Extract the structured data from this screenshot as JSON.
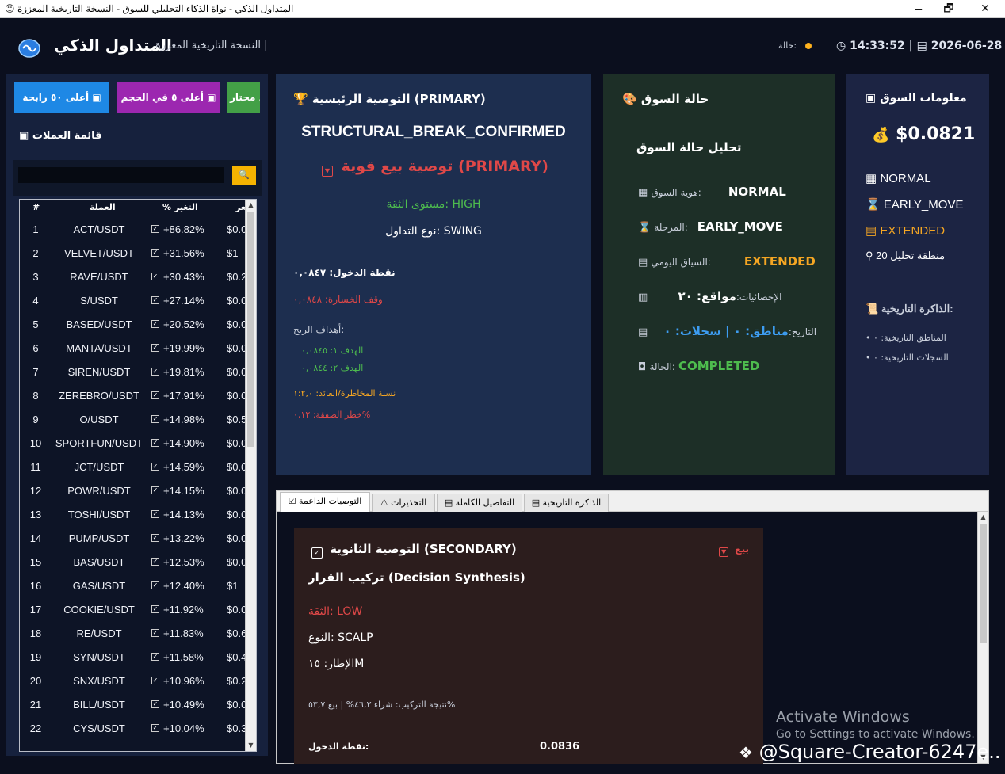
{
  "window": {
    "title": "المتداول الذكي - نواة الذكاء التحليلي للسوق - النسخة التاريخية المعززة",
    "minimize": "🗕",
    "maximize": "🗗",
    "close": "✕"
  },
  "header": {
    "app_title": "المتداول الذكي",
    "subtitle": "النسخة التاريخية المعززة |",
    "status_label": "حالة:",
    "status_color": "#ffb21e",
    "time": "14:33:52",
    "separator": "|",
    "date": "2026-06-28"
  },
  "filters": [
    {
      "label": "أعلى ٥٠ رابحة",
      "color": "#1e88e5"
    },
    {
      "label": "أعلى ٥ في الحجم",
      "color": "#9c27b0"
    },
    {
      "label": "ل مختار",
      "color": "#43a047"
    }
  ],
  "currency_list": {
    "title": "قائمة العملات",
    "search_icon": "search-icon",
    "columns": [
      "#",
      "العملة",
      "% التغير",
      "السعر"
    ],
    "rows": [
      {
        "n": "1",
        "symbol": "ACT/USDT",
        "change": "+86.82%",
        "price": "$0.0"
      },
      {
        "n": "2",
        "symbol": "VELVET/USDT",
        "change": "+31.56%",
        "price": "$1"
      },
      {
        "n": "3",
        "symbol": "RAVE/USDT",
        "change": "+30.43%",
        "price": "$0.2"
      },
      {
        "n": "4",
        "symbol": "S/USDT",
        "change": "+27.14%",
        "price": "$0.0"
      },
      {
        "n": "5",
        "symbol": "BASED/USDT",
        "change": "+20.52%",
        "price": "$0.0"
      },
      {
        "n": "6",
        "symbol": "MANTA/USDT",
        "change": "+19.99%",
        "price": "$0.0"
      },
      {
        "n": "7",
        "symbol": "SIREN/USDT",
        "change": "+19.81%",
        "price": "$0.0"
      },
      {
        "n": "8",
        "symbol": "ZEREBRO/USDT",
        "change": "+17.91%",
        "price": "$0.0"
      },
      {
        "n": "9",
        "symbol": "O/USDT",
        "change": "+14.98%",
        "price": "$0.5"
      },
      {
        "n": "10",
        "symbol": "SPORTFUN/USDT",
        "change": "+14.90%",
        "price": "$0.0"
      },
      {
        "n": "11",
        "symbol": "JCT/USDT",
        "change": "+14.59%",
        "price": "$0.00"
      },
      {
        "n": "12",
        "symbol": "POWR/USDT",
        "change": "+14.15%",
        "price": "$0.0"
      },
      {
        "n": "13",
        "symbol": "TOSHI/USDT",
        "change": "+14.13%",
        "price": "$0.00"
      },
      {
        "n": "14",
        "symbol": "PUMP/USDT",
        "change": "+13.22%",
        "price": "$0.00"
      },
      {
        "n": "15",
        "symbol": "BAS/USDT",
        "change": "+12.53%",
        "price": "$0.0"
      },
      {
        "n": "16",
        "symbol": "GAS/USDT",
        "change": "+12.40%",
        "price": "$1"
      },
      {
        "n": "17",
        "symbol": "COOKIE/USDT",
        "change": "+11.92%",
        "price": "$0.00"
      },
      {
        "n": "18",
        "symbol": "RE/USDT",
        "change": "+11.83%",
        "price": "$0.6"
      },
      {
        "n": "19",
        "symbol": "SYN/USDT",
        "change": "+11.58%",
        "price": "$0.4"
      },
      {
        "n": "20",
        "symbol": "SNX/USDT",
        "change": "+10.96%",
        "price": "$0.2"
      },
      {
        "n": "21",
        "symbol": "BILL/USDT",
        "change": "+10.49%",
        "price": "$0.0"
      },
      {
        "n": "22",
        "symbol": "CYS/USDT",
        "change": "+10.04%",
        "price": "$0.3"
      }
    ]
  },
  "primary": {
    "heading": "التوصية الرئيسية (PRIMARY)",
    "structure": "STRUCTURAL_BREAK_CONFIRMED",
    "recommendation": "توصية بيع قوية (PRIMARY)",
    "confidence": "مستوى الثقة: HIGH",
    "trade_type": "نوع التداول: SWING",
    "entry": "نقطة الدخول: ٠,٠٨٤٧",
    "stop_loss": "وقف الخسارة: ٠,٠٨٤٨",
    "targets_label": "أهداف الربح:",
    "target1": "الهدف ١: ٠,٠٨٤٥",
    "target2": "الهدف ٢: ٠,٠٨٤٤",
    "risk_reward": "نسبة المخاطرة/العائد: ١:٢,٠",
    "trade_risk": "خطر الصفقة: ٠,١٢%",
    "colors": {
      "sell": "#e04848",
      "high": "#4ebd4e",
      "rr": "#f5a623"
    }
  },
  "market_status": {
    "heading": "حالة السوق",
    "subheading": "تحليل حالة السوق",
    "rows": [
      {
        "label": "هوية السوق:",
        "value": "NORMAL",
        "color": "#ffffff"
      },
      {
        "label": "المرحلة:",
        "value": "EARLY_MOVE",
        "color": "#ffffff"
      },
      {
        "label": "السياق اليومي:",
        "value": "EXTENDED",
        "color": "#f5a623"
      },
      {
        "label": "الإحصائيات:",
        "value": "مواقع: ٢٠",
        "color": "#ffffff"
      },
      {
        "label": "التاريخ:",
        "value": "مناطق: ٠ | سجلات: ٠",
        "color": "#3d9df2"
      },
      {
        "label": "الحالة:",
        "value": "COMPLETED",
        "color": "#4ebd4e"
      }
    ]
  },
  "market_info": {
    "heading": "معلومات السوق",
    "price": "$0.0821",
    "identity": "NORMAL",
    "phase": "EARLY_MOVE",
    "context": "EXTENDED",
    "zone": "منطقة تحليل 20",
    "memory_heading": "الذاكرة التاريخية:",
    "zones": "المناطق التاريخية: ٠",
    "records": "السجلات التاريخية: ٠"
  },
  "tabs": [
    {
      "label": "التوصيات الداعمة",
      "icon": "check-icon"
    },
    {
      "label": "التحذيرات",
      "icon": "warning-icon"
    },
    {
      "label": "التفاصيل الكاملة",
      "icon": "document-icon"
    },
    {
      "label": "الذاكرة التاريخية",
      "icon": "history-icon"
    }
  ],
  "secondary": {
    "heading": "التوصية الثانوية (SECONDARY)",
    "sell": "بيع",
    "synthesis": "تركيب القرار (Decision Synthesis)",
    "confidence": "الثقة: LOW",
    "type": "النوع: SCALP",
    "timeframe": "الإطار: ١٥M",
    "result": "نتيجة التركيب: شراء ٤٦,٣% | بيع ٥٣,٧%",
    "entry_label": "نقطة الدخول:",
    "entry_value": "0.0836"
  },
  "overlay": {
    "activate_title": "Activate Windows",
    "activate_sub": "Go to Settings to activate Windows.",
    "creator": "@Square-Creator-6247e..."
  }
}
